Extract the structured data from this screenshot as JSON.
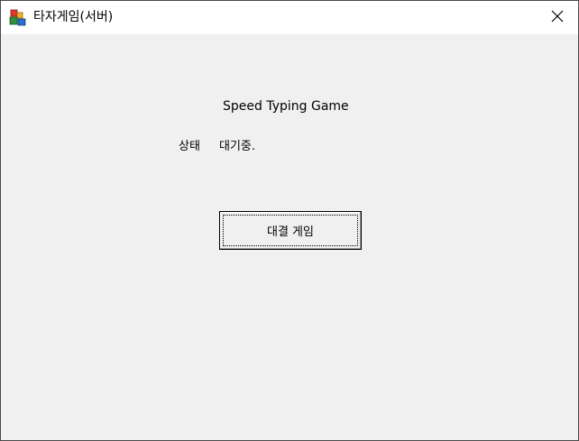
{
  "window": {
    "title": "타자게임(서버)",
    "app_icon": "app-icon",
    "close_icon": "close-icon"
  },
  "main": {
    "game_title": "Speed Typing Game",
    "status_label": "상태",
    "status_value": "대기중.",
    "match_button_label": "대결 게임"
  },
  "colors": {
    "titlebar_bg": "#ffffff",
    "client_bg": "#f0f0f0",
    "text": "#000000"
  }
}
